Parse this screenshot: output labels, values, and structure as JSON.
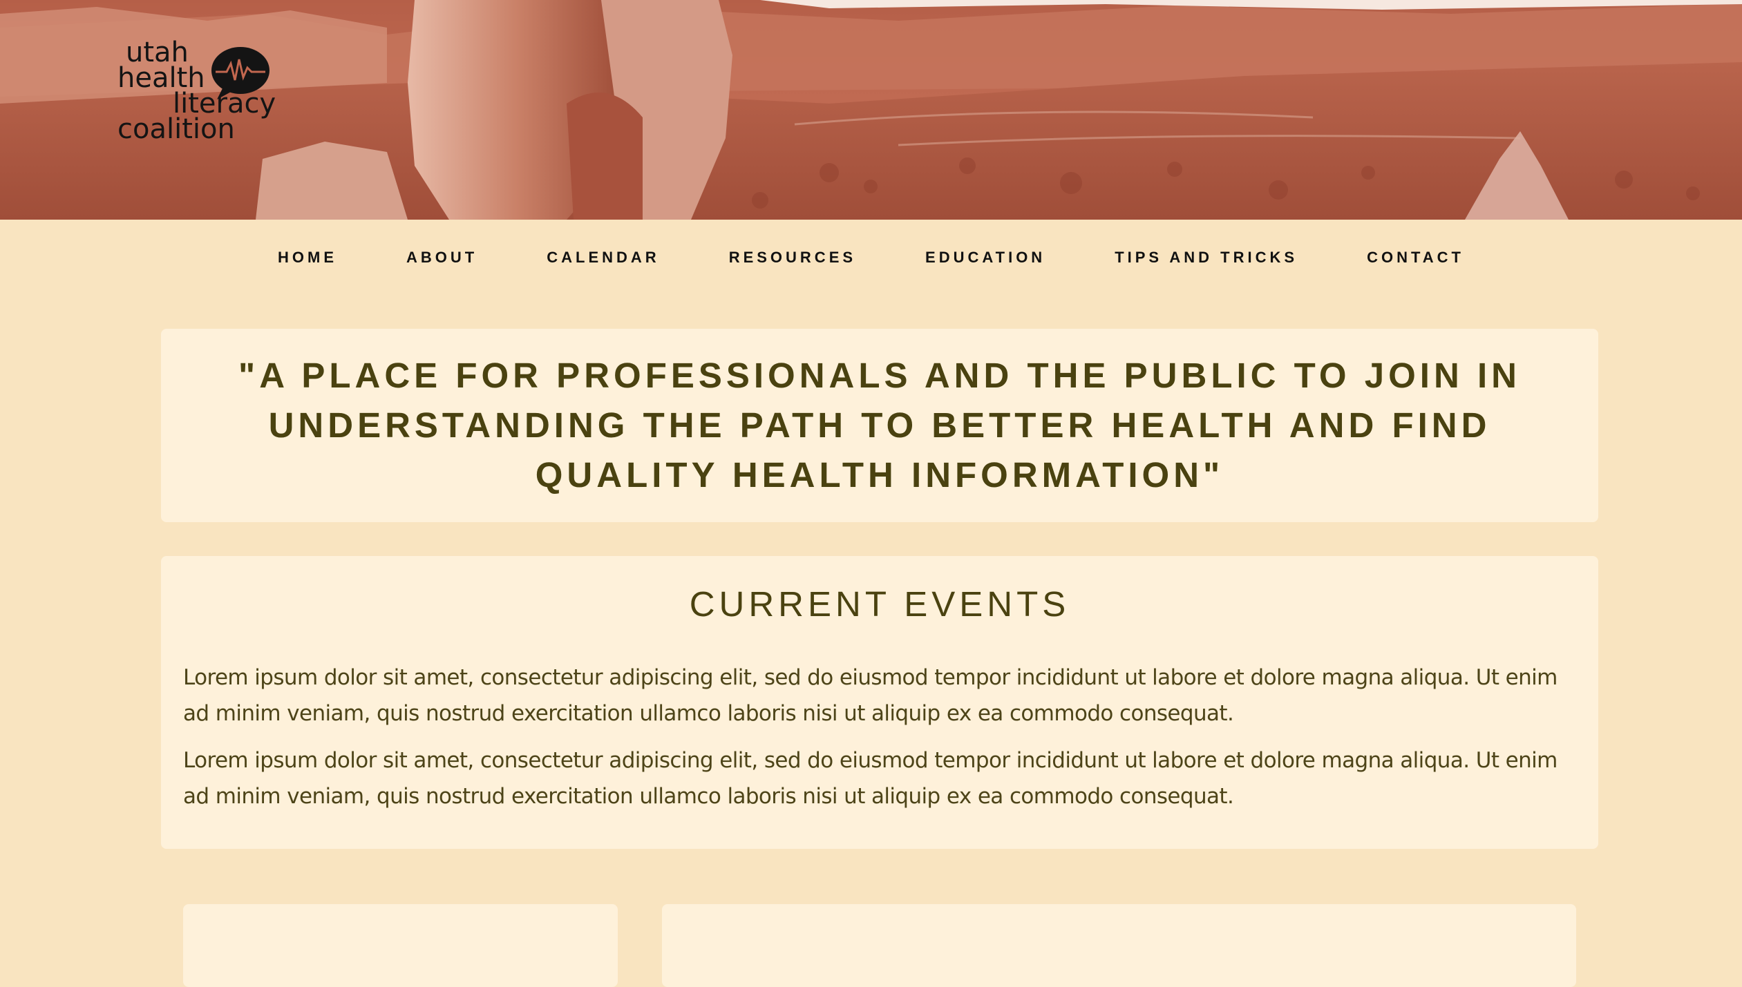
{
  "brand": {
    "logo_lines": [
      "utah",
      "health",
      "literacy",
      "coalition"
    ],
    "logo_icon": "heartbeat-speech-bubble-icon"
  },
  "nav": {
    "items": [
      {
        "label": "HOME"
      },
      {
        "label": "ABOUT"
      },
      {
        "label": "CALENDAR"
      },
      {
        "label": "RESOURCES"
      },
      {
        "label": "EDUCATION"
      },
      {
        "label": "TIPS AND TRICKS"
      },
      {
        "label": "CONTACT"
      }
    ]
  },
  "quote": {
    "text": "\"A PLACE FOR PROFESSIONALS AND THE PUBLIC TO JOIN IN UNDERSTANDING THE PATH TO BETTER HEALTH AND FIND QUALITY HEALTH INFORMATION\""
  },
  "events": {
    "title": "CURRENT EVENTS",
    "paragraphs": [
      "Lorem ipsum dolor sit amet, consectetur adipiscing elit, sed do eiusmod tempor incididunt ut labore et dolore magna aliqua. Ut enim ad minim veniam, quis nostrud exercitation ullamco laboris nisi ut aliquip ex ea commodo consequat.",
      "Lorem ipsum dolor sit amet, consectetur adipiscing elit, sed do eiusmod tempor incididunt ut labore et dolore magna aliqua. Ut enim ad minim veniam, quis nostrud exercitation ullamco laboris nisi ut aliquip ex ea commodo consequat."
    ]
  },
  "colors": {
    "page_background": "#f9e4c0",
    "card_background": "#fef1da",
    "heading_text": "#4a4210",
    "hero_tint": "#b55f48",
    "nav_text": "#111111"
  }
}
